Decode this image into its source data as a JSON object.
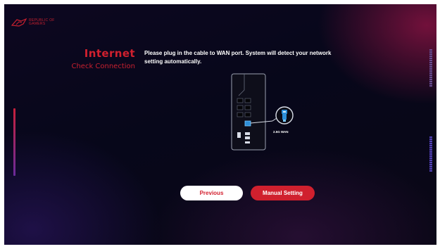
{
  "brand": {
    "logo_text": "REPUBLIC OF\nGAMERS",
    "logo_icon": "rog-eye-icon",
    "accent_color": "#d0202e"
  },
  "page": {
    "title": "Internet",
    "subtitle": "Check Connection",
    "instruction": "Please plug in the cable to WAN port. System will detect your network setting automatically."
  },
  "diagram": {
    "port_label": "2.5G WAN",
    "icon": "ethernet-plug-icon"
  },
  "buttons": {
    "previous": "Previous",
    "manual": "Manual Setting"
  }
}
